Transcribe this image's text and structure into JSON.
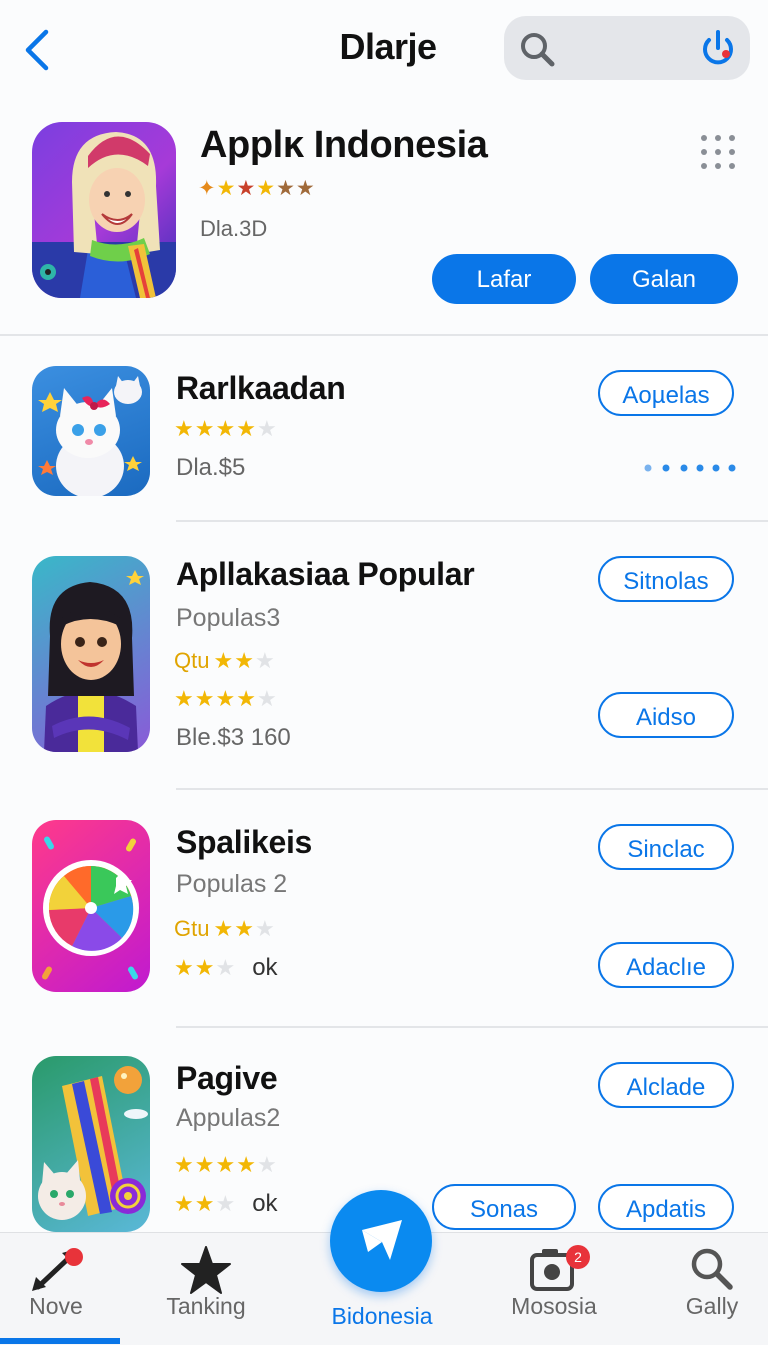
{
  "header": {
    "title": "Dlarje",
    "search_placeholder": ""
  },
  "featured": {
    "name": "Applĸ Indonesia",
    "stars": [
      {
        "glyph": "✦",
        "tone": "o"
      },
      {
        "glyph": "★",
        "tone": "y"
      },
      {
        "glyph": "★",
        "tone": "r"
      },
      {
        "glyph": "★",
        "tone": "y"
      },
      {
        "glyph": "★",
        "tone": "b"
      },
      {
        "glyph": "★",
        "tone": "b"
      }
    ],
    "price": "Dla.3D",
    "button_1": "Lafar",
    "button_2": "Galan"
  },
  "apps": [
    {
      "name": "Rarlkaadan",
      "rating_rows": [
        {
          "label": "",
          "filled": 4,
          "total": 5,
          "extra": ""
        }
      ],
      "price": "Dla.$5",
      "buttons": [
        "Aoµelas"
      ]
    },
    {
      "name": "Apllakasiaa Popular",
      "subtitle": "Populas3",
      "rating_rows": [
        {
          "label": "Qtu",
          "filled": 2,
          "total": 3,
          "extra": ""
        },
        {
          "label": "",
          "filled": 4,
          "total": 5,
          "extra": ""
        }
      ],
      "price": "Ble.$3 160",
      "buttons": [
        "Sitnolas",
        "Aidso"
      ]
    },
    {
      "name": "Spalikeis",
      "subtitle": "Populas 2",
      "rating_rows": [
        {
          "label": "Gtu",
          "filled": 2,
          "total": 3,
          "extra": ""
        },
        {
          "label": "",
          "filled": 2,
          "total": 3,
          "extra": "ok"
        }
      ],
      "buttons": [
        "Sinclac",
        "Adaclıe"
      ]
    },
    {
      "name": "Pagive",
      "subtitle": "Appulas2",
      "rating_rows": [
        {
          "label": "",
          "filled": 4,
          "total": 5,
          "extra": ""
        },
        {
          "label": "",
          "filled": 2,
          "total": 3,
          "extra": "ok"
        }
      ],
      "buttons": [
        "Alclade",
        "Sonas",
        "Apdatis"
      ]
    }
  ],
  "tabbar": {
    "tabs": [
      "Nove",
      "Tanking",
      "Bidonesia",
      "Mososia",
      "Gally"
    ],
    "mososia_badge": "2"
  },
  "colors": {
    "accent": "#0a76e8",
    "star": "#f2b705"
  }
}
